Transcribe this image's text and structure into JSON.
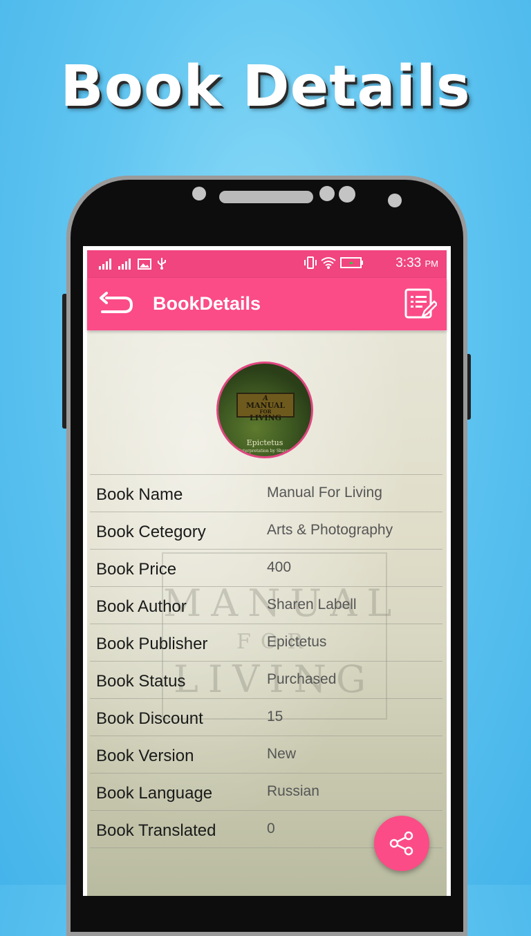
{
  "promo": {
    "headline": "Book Details"
  },
  "statusbar": {
    "time": "3:33",
    "ampm": "PM",
    "icons": [
      "signal-1-icon",
      "signal-2-icon",
      "image-icon",
      "usb-icon",
      "vibrate-icon",
      "wifi-icon",
      "battery-icon"
    ]
  },
  "appbar": {
    "title": "BookDetails",
    "back_icon": "back-arrow-icon",
    "action_icon": "notes-edit-icon"
  },
  "cover": {
    "title_line1": "A",
    "title_line2": "MANUAL",
    "title_line3": "FOR",
    "title_line4": "LIVING",
    "author": "Epictetus",
    "subtitle": "A New Interpretation by Sharon Lebell"
  },
  "details": [
    {
      "label": "Book Name",
      "value": "Manual For Living"
    },
    {
      "label": "Book Cetegory",
      "value": "Arts & Photography"
    },
    {
      "label": "Book Price",
      "value": "400"
    },
    {
      "label": "Book Author",
      "value": "Sharen Labell"
    },
    {
      "label": "Book Publisher",
      "value": "Epictetus"
    },
    {
      "label": "Book Status",
      "value": "Purchased"
    },
    {
      "label": "Book Discount",
      "value": "15"
    },
    {
      "label": "Book Version",
      "value": "New"
    },
    {
      "label": "Book Language",
      "value": "Russian"
    },
    {
      "label": "Book Translated",
      "value": "0"
    }
  ],
  "fab": {
    "icon": "share-icon"
  },
  "colors": {
    "accent": "#fb4c87",
    "statusbar": "#f0457f",
    "background": "#62c6f1"
  }
}
